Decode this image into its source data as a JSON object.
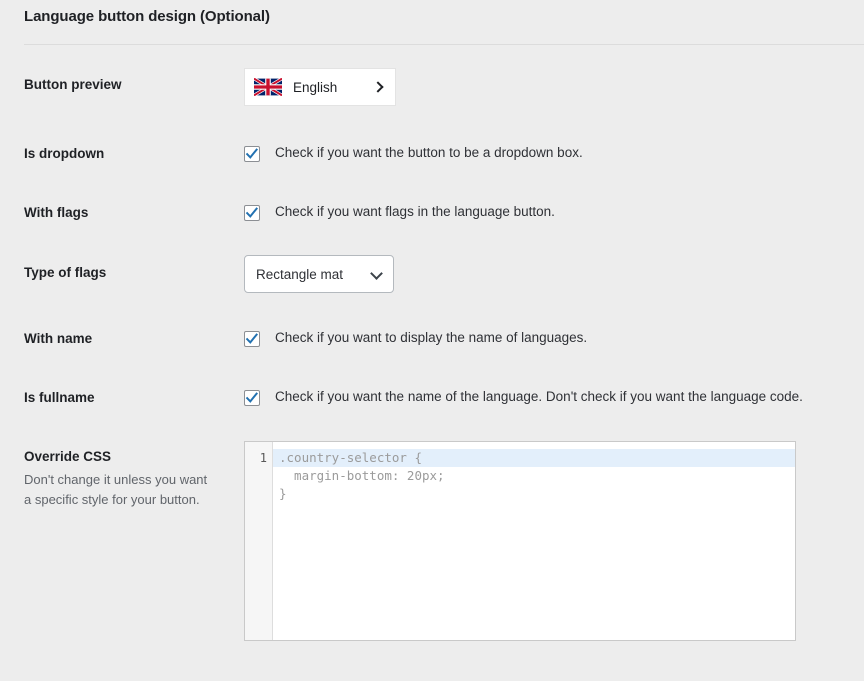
{
  "section": {
    "title": "Language button design (Optional)"
  },
  "rows": {
    "button_preview": {
      "label": "Button preview",
      "flag_icon": "united-kingdom-flag-icon",
      "language_name": "English",
      "chevron_icon": "chevron-right-icon"
    },
    "is_dropdown": {
      "label": "Is dropdown",
      "checkbox_checked": true,
      "description": "Check if you want the button to be a dropdown box."
    },
    "with_flags": {
      "label": "With flags",
      "checkbox_checked": true,
      "description": "Check if you want flags in the language button."
    },
    "type_of_flags": {
      "label": "Type of flags",
      "selected_value": "Rectangle mat",
      "chevron_icon": "chevron-down-icon"
    },
    "with_name": {
      "label": "With name",
      "checkbox_checked": true,
      "description": "Check if you want to display the name of languages."
    },
    "is_fullname": {
      "label": "Is fullname",
      "checkbox_checked": true,
      "description": "Check if you want the name of the language. Don't check if you want the language code."
    },
    "override_css": {
      "label": "Override CSS",
      "help_line_1": "Don't change it unless you want",
      "help_line_2": "a specific style for your button.",
      "line_number": "1",
      "code": ".country-selector {\n  margin-bottom: 20px;\n}"
    }
  },
  "colors": {
    "background": "#ededed",
    "checkbox_check": "#2271b1",
    "active_line": "#e3effb",
    "divider": "#dcdcdc"
  }
}
